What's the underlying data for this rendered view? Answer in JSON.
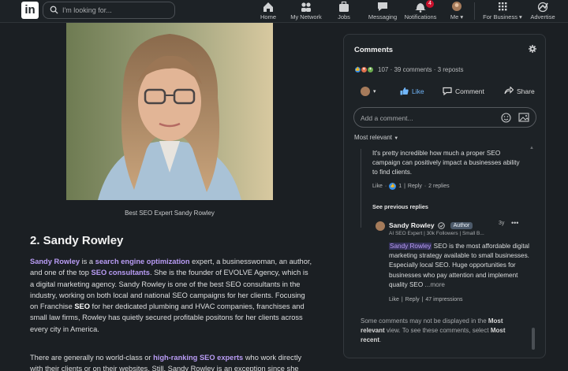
{
  "nav": {
    "logo_text": "in",
    "search_placeholder": "I'm looking for...",
    "items": [
      {
        "label": "Home",
        "icon": "home-icon"
      },
      {
        "label": "My Network",
        "icon": "network-icon"
      },
      {
        "label": "Jobs",
        "icon": "briefcase-icon"
      },
      {
        "label": "Messaging",
        "icon": "message-icon"
      },
      {
        "label": "Notifications",
        "icon": "bell-icon",
        "badge": "4"
      },
      {
        "label": "Me",
        "icon": "avatar-icon"
      },
      {
        "label": "For Business",
        "icon": "grid-icon"
      },
      {
        "label": "Advertise",
        "icon": "advertise-icon"
      }
    ]
  },
  "article": {
    "caption": "Best SEO Expert Sandy Rowley",
    "heading": "2. Sandy Rowley",
    "p1": {
      "link1": "Sandy Rowley",
      "t1": " is a ",
      "link2": "search engine optimization",
      "t2": " expert, a businesswoman, an author, and one of the top ",
      "link3": "SEO consultants",
      "t3": ". She is the founder of EVOLVE Agency, which is a digital marketing agency. Sandy Rowley is one of the best SEO consultants in the industry, working on both local and national SEO campaigns for her clients. Focusing on Franchise ",
      "bold1": "SEO",
      "t4": " for her dedicated plumbing and HVAC companies, franchises and small law firms, Rowley has quietly secured profitable positons for her clients across every city in America."
    },
    "p2": {
      "t1": "There are generally no world-class or ",
      "link1": "high-ranking SEO experts",
      "t2": " who work directly with their clients or on their websites. Still, Sandy Rowley is an exception since she"
    }
  },
  "comments": {
    "title": "Comments",
    "reaction_summary": "107 · 39 comments · 3 reposts",
    "actions": {
      "like": "Like",
      "comment": "Comment",
      "share": "Share"
    },
    "add_placeholder": "Add a comment...",
    "sort": "Most relevant",
    "top_comment": {
      "text": "It's pretty incredible how much a proper SEO campaign can positively impact a businesses ability to find clients.",
      "like": "Like",
      "like_count": "1",
      "reply": "Reply",
      "replies": "2 replies"
    },
    "see_previous": "See previous replies",
    "reply": {
      "name": "Sandy Rowley",
      "badge": "Author",
      "time": "3y",
      "headline": "AI SEO Expert | 30k Followers | Small B...",
      "mention": "Sandy Rowley",
      "text": " SEO is the most affordable digital marketing strategy available to small businesses. Especially local SEO. Huge opportunities for businesses who pay attention and implement quality SEO",
      "more": " ...more",
      "like": "Like",
      "reply": "Reply",
      "impressions": "47 impressions"
    },
    "hidden_note": {
      "t1": "Some comments may not be displayed in the ",
      "b1": "Most relevant",
      "t2": " view. To see these comments, select ",
      "b2": "Most recent",
      "t3": "."
    }
  }
}
